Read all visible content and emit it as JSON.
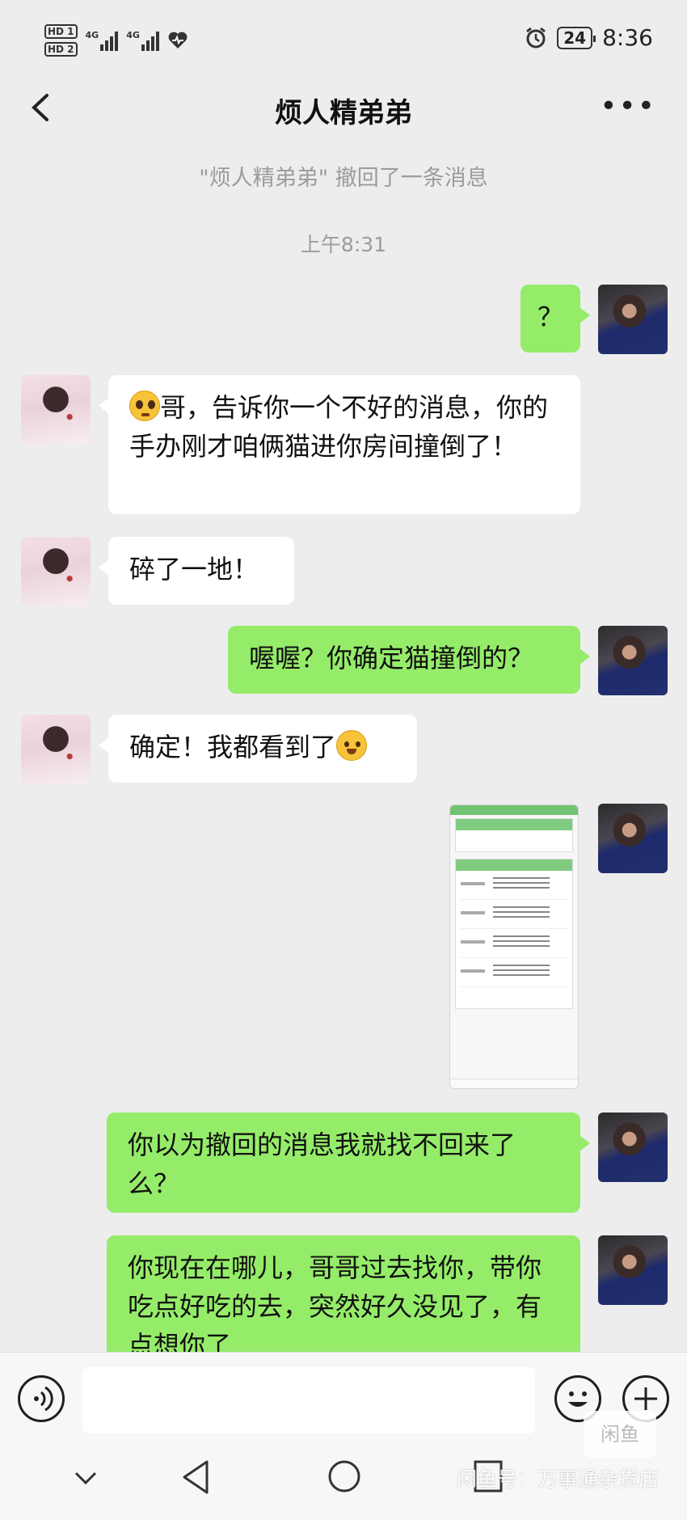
{
  "status_bar": {
    "hd1": "HD 1",
    "hd2": "HD 2",
    "signal1": "4G",
    "signal2": "4G",
    "battery": "24",
    "time": "8:36"
  },
  "header": {
    "title": "烦人精弟弟"
  },
  "system": {
    "recall_notice": "\"烦人精弟弟\" 撤回了一条消息",
    "timestamp": "上午8:31"
  },
  "messages": [
    {
      "side": "out",
      "text": "？"
    },
    {
      "side": "in",
      "text": "哥，告诉你一个不好的消息，你的手办刚才咱俩猫进你房间撞倒了！",
      "emoji": "pleading-face-icon"
    },
    {
      "side": "in",
      "text": "碎了一地！"
    },
    {
      "side": "out",
      "text": "喔喔？你确定猫撞倒的？"
    },
    {
      "side": "in",
      "text": "确定！我都看到了",
      "emoji": "smiling-face-icon"
    },
    {
      "side": "out",
      "type": "image"
    },
    {
      "side": "out",
      "text": "你以为撤回的消息我就找不回来了么？"
    },
    {
      "side": "out",
      "text": "你现在在哪儿，哥哥过去找你，带你吃点好吃的去，突然好久没见了，有点想你了"
    }
  ],
  "watermark": {
    "logo": "闲鱼",
    "text": "闲鱼号：万事通杂货店"
  }
}
